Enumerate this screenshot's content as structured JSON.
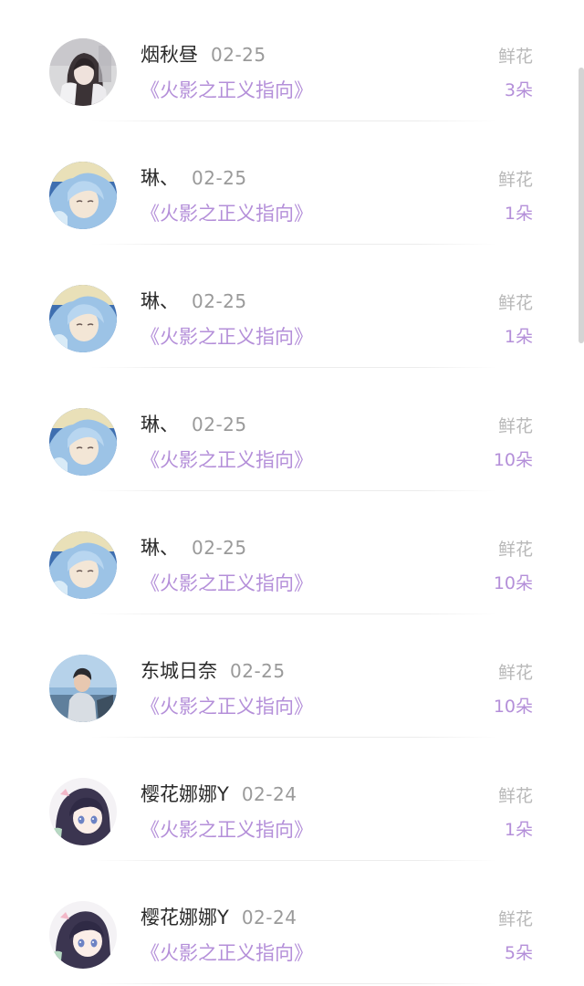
{
  "gift_label": "鲜花",
  "rows": [
    {
      "name": "烟秋昼",
      "date": "02-25",
      "book": "《火影之正义指向》",
      "count": "3朵",
      "avatar": "avatar-girl-dark-hair"
    },
    {
      "name": "琳、",
      "date": "02-25",
      "book": "《火影之正义指向》",
      "count": "1朵",
      "avatar": "avatar-blue-hair-anime"
    },
    {
      "name": "琳、",
      "date": "02-25",
      "book": "《火影之正义指向》",
      "count": "1朵",
      "avatar": "avatar-blue-hair-anime"
    },
    {
      "name": "琳、",
      "date": "02-25",
      "book": "《火影之正义指向》",
      "count": "10朵",
      "avatar": "avatar-blue-hair-anime"
    },
    {
      "name": "琳、",
      "date": "02-25",
      "book": "《火影之正义指向》",
      "count": "10朵",
      "avatar": "avatar-blue-hair-anime"
    },
    {
      "name": "东城日奈",
      "date": "02-25",
      "book": "《火影之正义指向》",
      "count": "10朵",
      "avatar": "avatar-photo-person"
    },
    {
      "name": "樱花娜娜Y",
      "date": "02-24",
      "book": "《火影之正义指向》",
      "count": "1朵",
      "avatar": "avatar-anime-girl"
    },
    {
      "name": "樱花娜娜Y",
      "date": "02-24",
      "book": "《火影之正义指向》",
      "count": "5朵",
      "avatar": "avatar-anime-girl"
    }
  ],
  "colors": {
    "accent": "#b48fd9",
    "name_text": "#2b2b2b",
    "date_text": "#9a9a9a",
    "gift_text": "#b8b8b8"
  }
}
